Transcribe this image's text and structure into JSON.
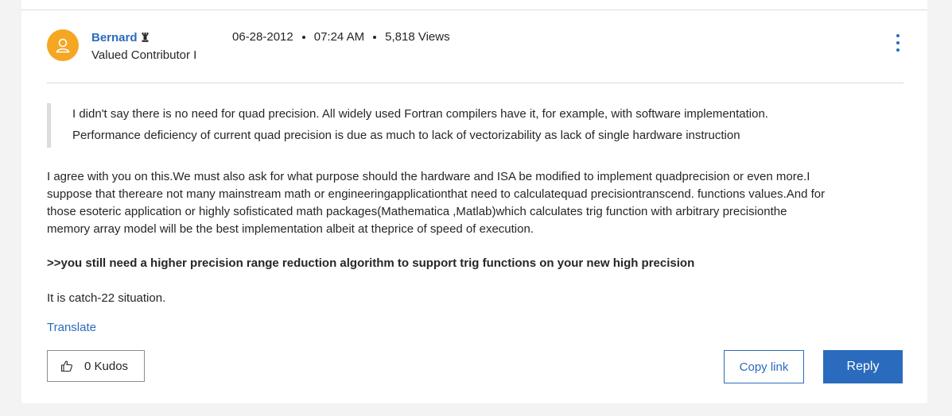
{
  "post": {
    "author": {
      "name": "Bernard",
      "rank": "Valued Contributor I",
      "avatar_icon": "user-icon",
      "rank_icon": "rank-tower-icon",
      "avatar_color": "#f5a623"
    },
    "date": "06-28-2012",
    "time": "07:24 AM",
    "views": "5,818 Views",
    "menu_icon": "kebab-menu-icon",
    "quote": {
      "line1": "I didn't say there is no need for quad precision. All widely used Fortran compilers have it, for example, with software implementation.",
      "line2": "Performance deficiency of current quad precision is due as much to lack of vectorizability as lack of single hardware instruction"
    },
    "body": {
      "line1": "I agree with you on this.We must also ask for what purpose should the hardware and ISA be modified to implement quadprecision or even more.I",
      "line2": "suppose that thereare not many mainstream math or engineeringapplicationthat need to calculatequad precisiontranscend. functions values.And for",
      "line3": "those esoteric application or highly sofisticated math packages(Mathematica ,Matlab)which calculates trig function with arbitrary precisionthe",
      "line4": "memory array model will be the best implementation albeit at theprice of speed of execution."
    },
    "bold_line": ">>you still need a higher precision range reduction algorithm to support trig functions on your new high precision",
    "closing_line": "It is catch-22 situation.",
    "translate_label": "Translate",
    "kudos_label": "0 Kudos",
    "kudos_icon": "thumbs-up-icon",
    "copy_link_label": "Copy link",
    "reply_label": "Reply",
    "colors": {
      "accent": "#2a6bbd",
      "text": "#262626",
      "background": "#f3f3f3"
    }
  }
}
